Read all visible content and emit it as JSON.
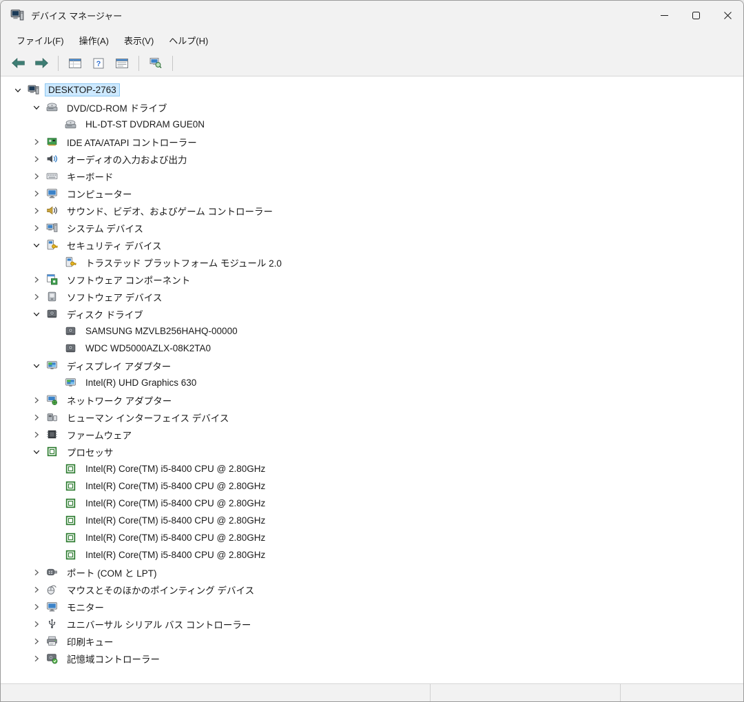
{
  "window": {
    "title": "デバイス マネージャー"
  },
  "menu": {
    "items": [
      {
        "name": "file",
        "label": "ファイル(F)"
      },
      {
        "name": "action",
        "label": "操作(A)"
      },
      {
        "name": "view",
        "label": "表示(V)"
      },
      {
        "name": "help",
        "label": "ヘルプ(H)"
      }
    ]
  },
  "toolbar": {
    "buttons": [
      {
        "name": "back",
        "icon": "back-arrow"
      },
      {
        "name": "forward",
        "icon": "forward-arrow"
      },
      {
        "divider": true
      },
      {
        "name": "console-tree",
        "icon": "console-window"
      },
      {
        "name": "help",
        "icon": "help"
      },
      {
        "name": "properties",
        "icon": "properties-window"
      },
      {
        "divider": true
      },
      {
        "name": "scan-hardware-changes",
        "icon": "scan"
      },
      {
        "divider": true
      },
      {
        "name": "devices",
        "icon": "monitor-blue"
      }
    ]
  },
  "tree": {
    "nodes": [
      {
        "label": "DESKTOP-2763",
        "level": 0,
        "expanded": true,
        "icon": "computer",
        "selected": true
      },
      {
        "label": "DVD/CD-ROM ドライブ",
        "level": 1,
        "expanded": true,
        "icon": "dvd"
      },
      {
        "label": "HL-DT-ST DVDRAM GUE0N",
        "level": 2,
        "icon": "dvd"
      },
      {
        "label": "IDE ATA/ATAPI コントローラー",
        "level": 1,
        "expanded": false,
        "icon": "ide"
      },
      {
        "label": "オーディオの入力および出力",
        "level": 1,
        "expanded": false,
        "icon": "audio"
      },
      {
        "label": "キーボード",
        "level": 1,
        "expanded": false,
        "icon": "keyboard"
      },
      {
        "label": "コンピューター",
        "level": 1,
        "expanded": false,
        "icon": "monitor-blue"
      },
      {
        "label": "サウンド、ビデオ、およびゲーム コントローラー",
        "level": 1,
        "expanded": false,
        "icon": "sound"
      },
      {
        "label": "システム デバイス",
        "level": 1,
        "expanded": false,
        "icon": "system"
      },
      {
        "label": "セキュリティ デバイス",
        "level": 1,
        "expanded": true,
        "icon": "security"
      },
      {
        "label": "トラステッド プラットフォーム モジュール 2.0",
        "level": 2,
        "icon": "security"
      },
      {
        "label": "ソフトウェア コンポーネント",
        "level": 1,
        "expanded": false,
        "icon": "sw-component"
      },
      {
        "label": "ソフトウェア デバイス",
        "level": 1,
        "expanded": false,
        "icon": "sw-device"
      },
      {
        "label": "ディスク ドライブ",
        "level": 1,
        "expanded": true,
        "icon": "disk"
      },
      {
        "label": "SAMSUNG MZVLB256HAHQ-00000",
        "level": 2,
        "icon": "disk"
      },
      {
        "label": "WDC WD5000AZLX-08K2TA0",
        "level": 2,
        "icon": "disk"
      },
      {
        "label": "ディスプレイ アダプター",
        "level": 1,
        "expanded": true,
        "icon": "display"
      },
      {
        "label": "Intel(R) UHD Graphics 630",
        "level": 2,
        "icon": "display"
      },
      {
        "label": "ネットワーク アダプター",
        "level": 1,
        "expanded": false,
        "icon": "network"
      },
      {
        "label": "ヒューマン インターフェイス デバイス",
        "level": 1,
        "expanded": false,
        "icon": "hid"
      },
      {
        "label": "ファームウェア",
        "level": 1,
        "expanded": false,
        "icon": "firmware"
      },
      {
        "label": "プロセッサ",
        "level": 1,
        "expanded": true,
        "icon": "cpu"
      },
      {
        "label": "Intel(R) Core(TM) i5-8400 CPU @ 2.80GHz",
        "level": 2,
        "icon": "cpu"
      },
      {
        "label": "Intel(R) Core(TM) i5-8400 CPU @ 2.80GHz",
        "level": 2,
        "icon": "cpu"
      },
      {
        "label": "Intel(R) Core(TM) i5-8400 CPU @ 2.80GHz",
        "level": 2,
        "icon": "cpu"
      },
      {
        "label": "Intel(R) Core(TM) i5-8400 CPU @ 2.80GHz",
        "level": 2,
        "icon": "cpu"
      },
      {
        "label": "Intel(R) Core(TM) i5-8400 CPU @ 2.80GHz",
        "level": 2,
        "icon": "cpu"
      },
      {
        "label": "Intel(R) Core(TM) i5-8400 CPU @ 2.80GHz",
        "level": 2,
        "icon": "cpu"
      },
      {
        "label": "ポート (COM と LPT)",
        "level": 1,
        "expanded": false,
        "icon": "ports"
      },
      {
        "label": "マウスとそのほかのポインティング デバイス",
        "level": 1,
        "expanded": false,
        "icon": "mouse"
      },
      {
        "label": "モニター",
        "level": 1,
        "expanded": false,
        "icon": "monitor-blue"
      },
      {
        "label": "ユニバーサル シリアル バス コントローラー",
        "level": 1,
        "expanded": false,
        "icon": "usb"
      },
      {
        "label": "印刷キュー",
        "level": 1,
        "expanded": false,
        "icon": "printer"
      },
      {
        "label": "記憶域コントローラー",
        "level": 1,
        "expanded": false,
        "icon": "storage"
      }
    ]
  },
  "statusbar": {
    "sections": [
      "",
      "",
      ""
    ]
  }
}
